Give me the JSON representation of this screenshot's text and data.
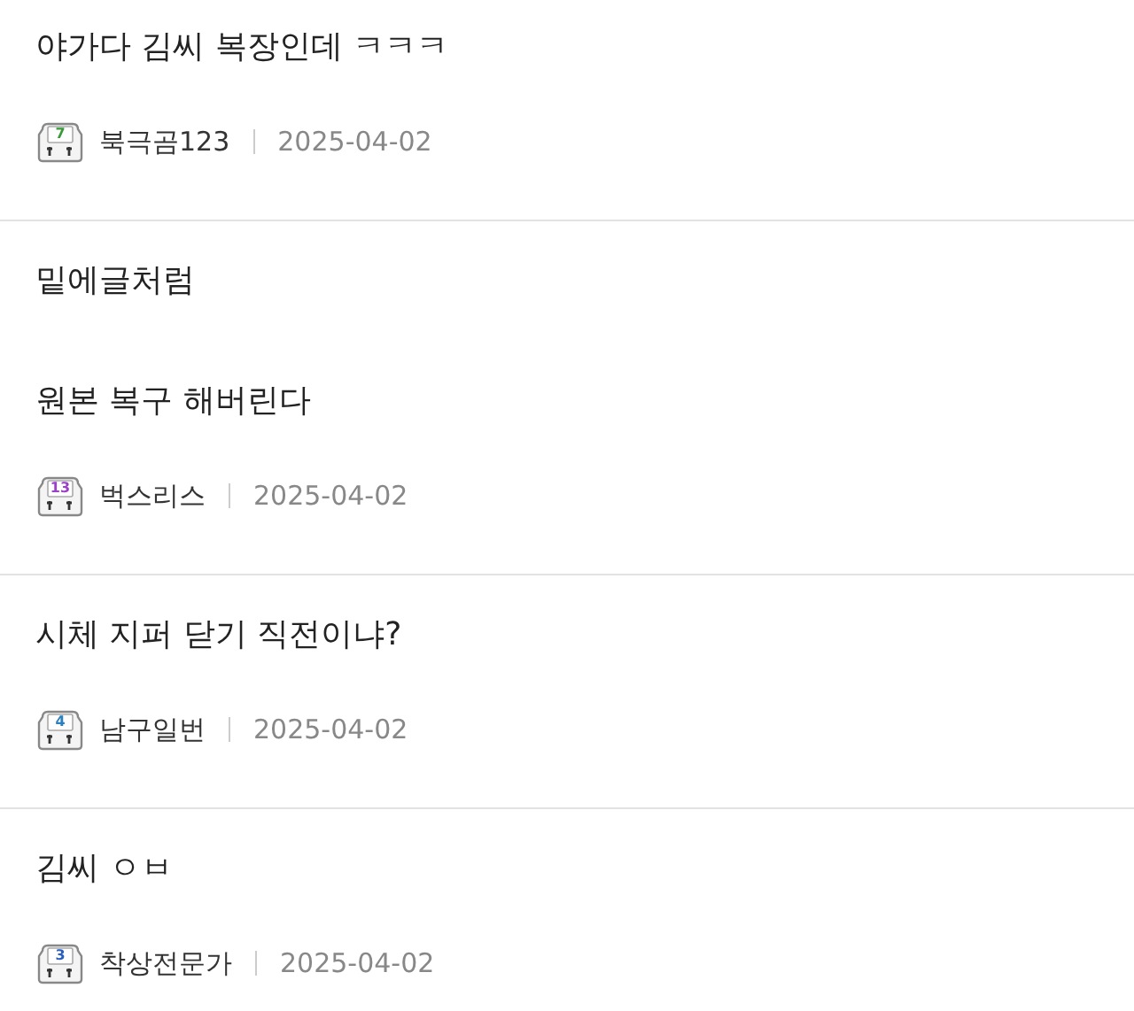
{
  "comments": [
    {
      "paragraphs": [
        "야가다 김씨 복장인데 ㅋㅋㅋ"
      ],
      "level": {
        "text": "7",
        "color": "#3a9a3a"
      },
      "author": "북극곰123",
      "date": "2025-04-02"
    },
    {
      "paragraphs": [
        "밑에글처럼",
        "원본 복구 해버린다"
      ],
      "level": {
        "text": "13",
        "color": "#9b3fc8"
      },
      "author": "벅스리스",
      "date": "2025-04-02"
    },
    {
      "paragraphs": [
        "시체 지퍼 닫기 직전이냐?"
      ],
      "level": {
        "text": "4",
        "color": "#2a7fc0"
      },
      "author": "남구일번",
      "date": "2025-04-02"
    },
    {
      "paragraphs": [
        "김씨 ㅇㅂ"
      ],
      "level": {
        "text": "3",
        "color": "#2a5fc0"
      },
      "author": "착상전문가",
      "date": "2025-04-02"
    }
  ]
}
